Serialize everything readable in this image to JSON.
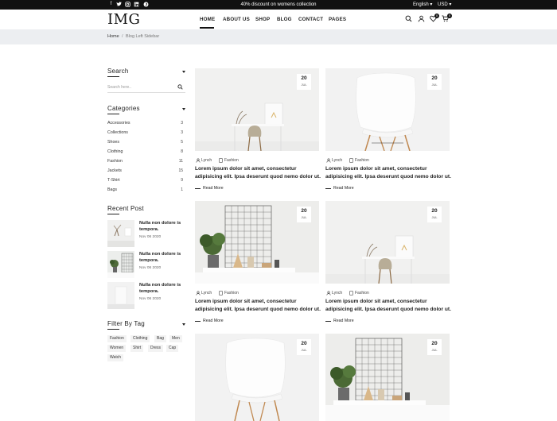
{
  "topbar": {
    "promo": "40% discount on womens collection",
    "language": "English",
    "currency": "USD",
    "social": [
      "facebook-icon",
      "twitter-icon",
      "instagram-icon",
      "linkedin-icon",
      "pinterest-icon"
    ]
  },
  "header": {
    "logo": "IMG",
    "nav": [
      "HOME",
      "ABOUT US",
      "SHOP",
      "BLOG",
      "CONTACT",
      "PAGES"
    ],
    "wishlist_count": "0",
    "cart_count": "0"
  },
  "breadcrumb": {
    "home": "Home",
    "separator": "/",
    "current": "Blog Left Sidebar"
  },
  "sidebar": {
    "search": {
      "title": "Search",
      "placeholder": "Search here.."
    },
    "categories": {
      "title": "Categories",
      "items": [
        {
          "name": "Accessories",
          "count": "3"
        },
        {
          "name": "Collections",
          "count": "3"
        },
        {
          "name": "Shoes",
          "count": "5"
        },
        {
          "name": "Clothing",
          "count": "8"
        },
        {
          "name": "Fashion",
          "count": "11"
        },
        {
          "name": "Jackets",
          "count": "15"
        },
        {
          "name": "T-Shirt",
          "count": "9"
        },
        {
          "name": "Bags",
          "count": "1"
        }
      ]
    },
    "recent": {
      "title": "Recent Post",
      "items": [
        {
          "title": "Nulla non dolore is tempora.",
          "date": "Nov 06 2020"
        },
        {
          "title": "Nulla non dolore is tempora.",
          "date": "Nov 06 2020"
        },
        {
          "title": "Nulla non dolore is tempora.",
          "date": "Nov 06 2020"
        }
      ]
    },
    "tags": {
      "title": "Filter By Tag",
      "items": [
        "Fashion",
        "Clothing",
        "Bag",
        "Men",
        "Women",
        "Shirt",
        "Dress",
        "Cap",
        "Watch"
      ]
    }
  },
  "posts": [
    {
      "day": "20",
      "month": "JUL",
      "author": "Lynch",
      "category": "Fashion",
      "title": "Lorem ipsum dolor sit amet, consectetur adipisicing elit. Ipsa deserunt quod nemo dolor ut.",
      "read_more": "Read More"
    },
    {
      "day": "20",
      "month": "JUL",
      "author": "Lynch",
      "category": "Fashion",
      "title": "Lorem ipsum dolor sit amet, consectetur adipisicing elit. Ipsa deserunt quod nemo dolor ut.",
      "read_more": "Read More"
    },
    {
      "day": "20",
      "month": "JUL",
      "author": "Lynch",
      "category": "Fashion",
      "title": "Lorem ipsum dolor sit amet, consectetur adipisicing elit. Ipsa deserunt quod nemo dolor ut.",
      "read_more": "Read More"
    },
    {
      "day": "20",
      "month": "JUL",
      "author": "Lynch",
      "category": "Fashion",
      "title": "Lorem ipsum dolor sit amet, consectetur adipisicing elit. Ipsa deserunt quod nemo dolor ut.",
      "read_more": "Read More"
    },
    {
      "day": "20",
      "month": "JUL"
    },
    {
      "day": "20",
      "month": "JUL"
    }
  ]
}
